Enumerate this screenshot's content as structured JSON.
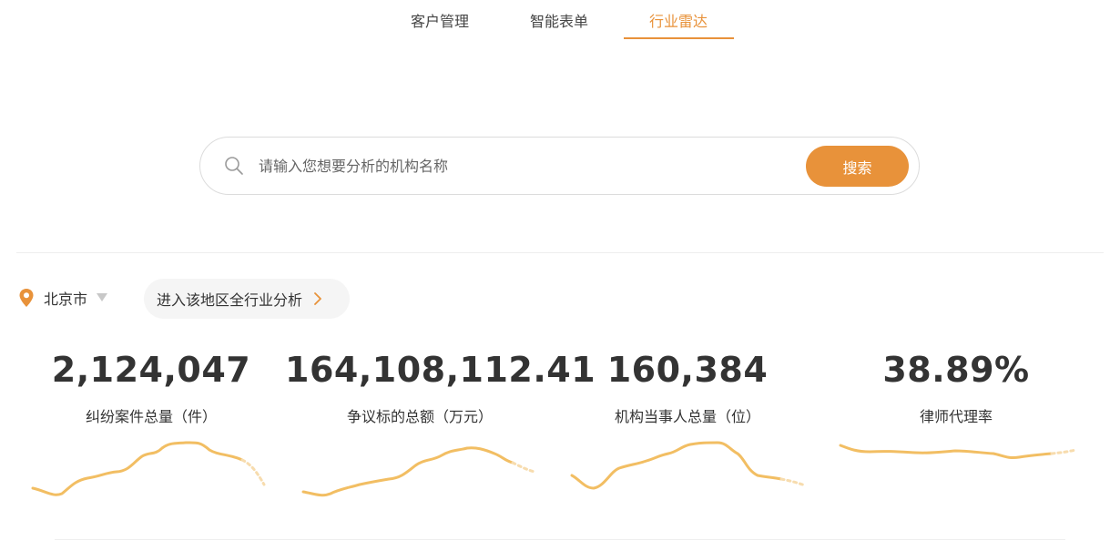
{
  "nav": {
    "tabs": [
      {
        "label": "客户管理",
        "active": false
      },
      {
        "label": "智能表单",
        "active": false
      },
      {
        "label": "行业雷达",
        "active": true
      }
    ]
  },
  "search": {
    "placeholder": "请输入您想要分析的机构名称",
    "value": "",
    "button_label": "搜索",
    "icon": "search-icon"
  },
  "region": {
    "city": "北京市",
    "icon": "location-pin-icon",
    "link_label": "进入该地区全行业分析"
  },
  "stats": [
    {
      "value": "2,124,047",
      "label": "纠纷案件总量（件）"
    },
    {
      "value": "164,108,112.41",
      "label": "争议标的总额（万元）"
    },
    {
      "value": "160,384",
      "label": "机构当事人总量（位）"
    },
    {
      "value": "38.89%",
      "label": "律师代理率"
    }
  ],
  "colors": {
    "accent": "#e8923a",
    "sparkline": "#f2be63",
    "sparkline_faded": "#f7dcae",
    "text": "#333333",
    "pill_bg": "#f5f5f5"
  }
}
